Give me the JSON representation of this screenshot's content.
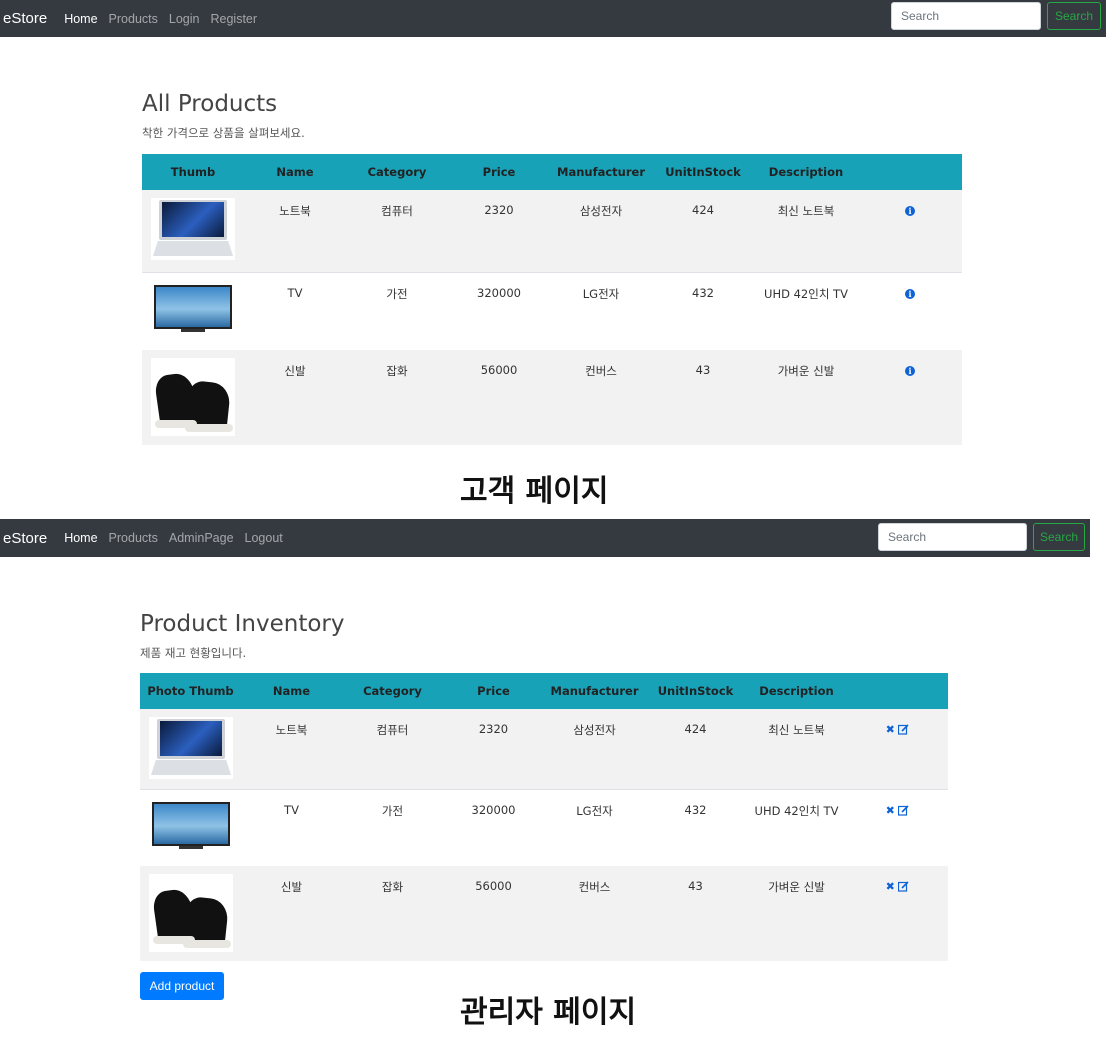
{
  "customer": {
    "nav": {
      "brand": "eStore",
      "items": [
        {
          "label": "Home",
          "active": true
        },
        {
          "label": "Products",
          "active": false
        },
        {
          "label": "Login",
          "active": false
        },
        {
          "label": "Register",
          "active": false
        }
      ],
      "search_placeholder": "Search",
      "search_button": "Search"
    },
    "title": "All Products",
    "subtitle": "착한 가격으로 상품을 살펴보세요.",
    "columns": [
      "Thumb",
      "Name",
      "Category",
      "Price",
      "Manufacturer",
      "UnitInStock",
      "Description"
    ],
    "products": [
      {
        "thumb": "laptop-thumbnail",
        "name": "노트북",
        "category": "컴퓨터",
        "price": "2320",
        "manufacturer": "삼성전자",
        "stock": "424",
        "description": "최신 노트북"
      },
      {
        "thumb": "tv-thumbnail",
        "name": "TV",
        "category": "가전",
        "price": "320000",
        "manufacturer": "LG전자",
        "stock": "432",
        "description": "UHD 42인치 TV"
      },
      {
        "thumb": "sneakers-thumbnail",
        "name": "신발",
        "category": "잡화",
        "price": "56000",
        "manufacturer": "컨버스",
        "stock": "43",
        "description": "가벼운 신발"
      }
    ],
    "action_icon": "info-circle-icon",
    "caption": "고객 페이지"
  },
  "admin": {
    "nav": {
      "brand": "eStore",
      "items": [
        {
          "label": "Home",
          "active": true
        },
        {
          "label": "Products",
          "active": false
        },
        {
          "label": "AdminPage",
          "active": false
        },
        {
          "label": "Logout",
          "active": false
        }
      ],
      "search_placeholder": "Search",
      "search_button": "Search"
    },
    "title": "Product Inventory",
    "subtitle": "제품 재고 현황입니다.",
    "columns": [
      "Photo Thumb",
      "Name",
      "Category",
      "Price",
      "Manufacturer",
      "UnitInStock",
      "Description"
    ],
    "products": [
      {
        "thumb": "laptop-thumbnail",
        "name": "노트북",
        "category": "컴퓨터",
        "price": "2320",
        "manufacturer": "삼성전자",
        "stock": "424",
        "description": "최신 노트북"
      },
      {
        "thumb": "tv-thumbnail",
        "name": "TV",
        "category": "가전",
        "price": "320000",
        "manufacturer": "LG전자",
        "stock": "432",
        "description": "UHD 42인치 TV"
      },
      {
        "thumb": "sneakers-thumbnail",
        "name": "신발",
        "category": "잡화",
        "price": "56000",
        "manufacturer": "컨버스",
        "stock": "43",
        "description": "가벼운 신발"
      }
    ],
    "action_icons": [
      "delete-x-icon",
      "edit-icon"
    ],
    "add_button": "Add product",
    "caption": "관리자 페이지"
  },
  "colors": {
    "navbar": "#343a40",
    "table_header": "#17a2b8",
    "search_button": "#28a745",
    "primary": "#007bff",
    "icon": "#0d62d6"
  }
}
